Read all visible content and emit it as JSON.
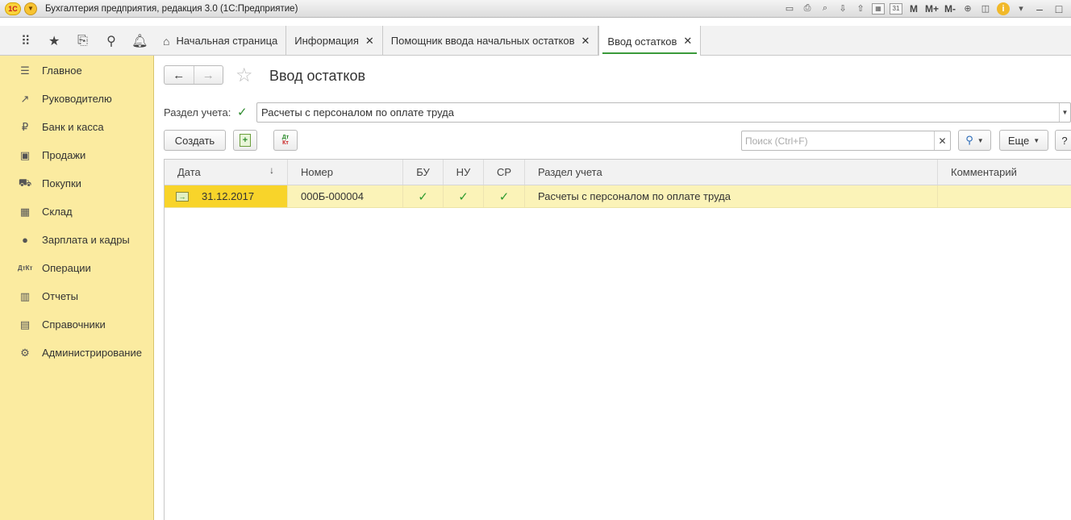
{
  "window": {
    "title": "Бухгалтерия предприятия, редакция 3.0  (1С:Предприятие)",
    "logo_text": "1С",
    "tools": [
      "М",
      "М+",
      "М-"
    ]
  },
  "tabs": [
    {
      "label": "Начальная страница"
    },
    {
      "label": "Информация"
    },
    {
      "label": "Помощник ввода начальных остатков"
    },
    {
      "label": "Ввод остатков"
    }
  ],
  "sidebar": {
    "items": [
      {
        "label": "Главное",
        "icon": "menu-icon"
      },
      {
        "label": "Руководителю",
        "icon": "trend-icon"
      },
      {
        "label": "Банк и касса",
        "icon": "ruble-icon"
      },
      {
        "label": "Продажи",
        "icon": "bag-icon"
      },
      {
        "label": "Покупки",
        "icon": "cart-icon"
      },
      {
        "label": "Склад",
        "icon": "warehouse-icon"
      },
      {
        "label": "Зарплата и кадры",
        "icon": "person-icon"
      },
      {
        "label": "Операции",
        "icon": "dtkt-icon"
      },
      {
        "label": "Отчеты",
        "icon": "bar-chart-icon"
      },
      {
        "label": "Справочники",
        "icon": "book-icon"
      },
      {
        "label": "Администрирование",
        "icon": "gear-icon"
      }
    ]
  },
  "page": {
    "title": "Ввод остатков",
    "section_label": "Раздел учета:",
    "section_value": "Расчеты с персоналом по оплате труда",
    "section_checked": true
  },
  "toolbar": {
    "create_label": "Создать",
    "dtkt_dt": "Дт",
    "dtkt_kt": "Кт",
    "search_placeholder": "Поиск (Ctrl+F)",
    "more_label": "Еще",
    "help_label": "?"
  },
  "table": {
    "columns": [
      "Дата",
      "Номер",
      "БУ",
      "НУ",
      "СР",
      "Раздел учета",
      "Комментарий"
    ],
    "rows": [
      {
        "date": "31.12.2017",
        "number": "000Б-000004",
        "bu": true,
        "nu": true,
        "sr": true,
        "section": "Расчеты с персоналом по оплате труда",
        "comment": ""
      }
    ]
  },
  "colors": {
    "sidebar_bg": "#fbeba0",
    "selected_row": "#fbf3b8",
    "selected_cell": "#f8d42a",
    "check_green": "#2e9a2e"
  }
}
